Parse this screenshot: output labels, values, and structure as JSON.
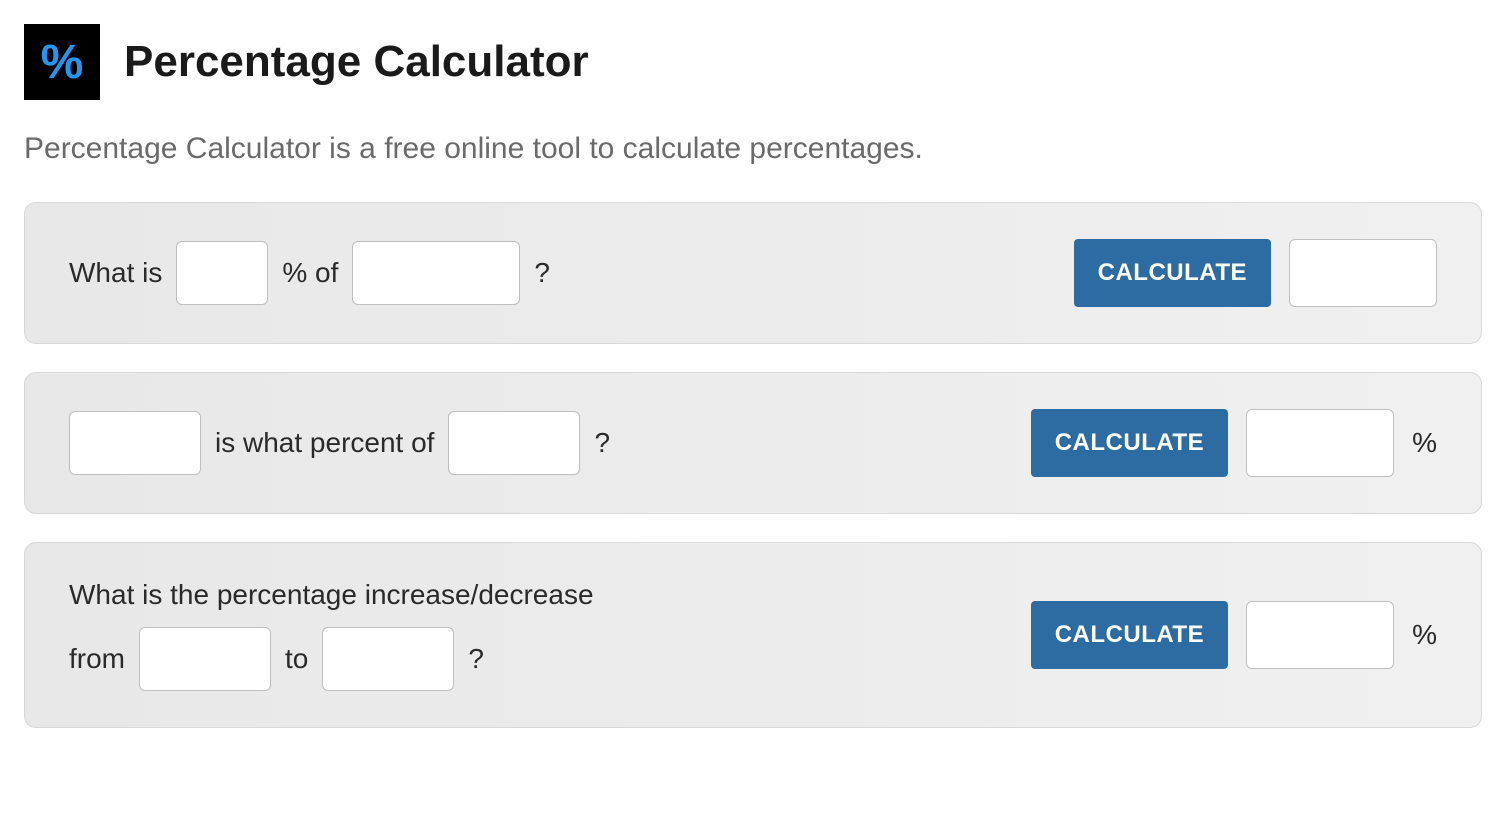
{
  "header": {
    "logo_symbol": "%",
    "title": "Percentage Calculator"
  },
  "description": "Percentage Calculator is a free online tool to calculate percentages.",
  "cards": {
    "card1": {
      "text_prefix": "What is",
      "text_mid": "% of",
      "text_suffix": "?",
      "button": "CALCULATE",
      "input1_value": "",
      "input2_value": "",
      "result_value": ""
    },
    "card2": {
      "text_mid": "is what percent of",
      "text_suffix": "?",
      "button": "CALCULATE",
      "result_unit": "%",
      "input1_value": "",
      "input2_value": "",
      "result_value": ""
    },
    "card3": {
      "text_line1": "What is the percentage increase/decrease",
      "text_prefix": "from",
      "text_mid": "to",
      "text_suffix": "?",
      "button": "CALCULATE",
      "result_unit": "%",
      "input1_value": "",
      "input2_value": "",
      "result_value": ""
    }
  }
}
